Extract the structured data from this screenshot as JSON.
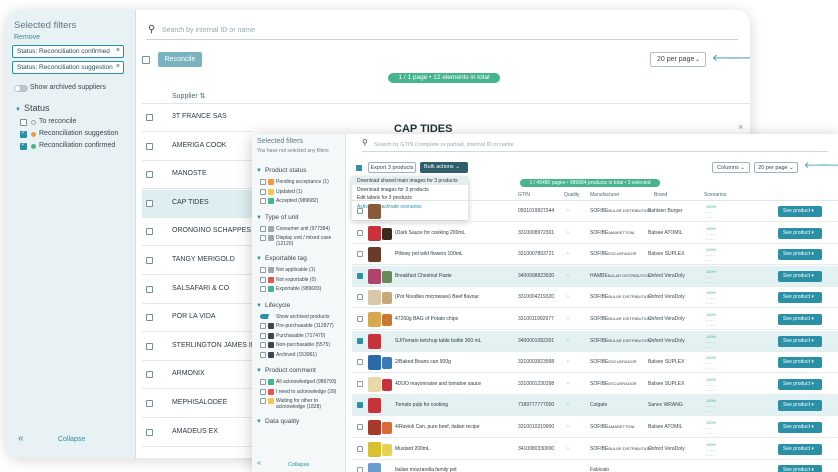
{
  "back": {
    "sidebar": {
      "title": "Selected filters",
      "remove": "Remove",
      "chips": [
        "Status: Reconciliation confirmed",
        "Status: Reconciliation suggestion"
      ],
      "chip_close": "×",
      "show_archived": "Show archived suppliers",
      "status_title": "Status",
      "status_options": [
        {
          "label": "To reconcile",
          "checked": false,
          "color": "#ffffff"
        },
        {
          "label": "Reconciliation suggestion",
          "checked": true,
          "color": "#f29a3a"
        },
        {
          "label": "Reconciliation confirmed",
          "checked": true,
          "color": "#46b58e"
        }
      ],
      "collapse": "Collapse",
      "collapse_icon": "«"
    },
    "search_placeholder": "Search by internal ID or name",
    "reconcile": "Reconcile",
    "per_page": "20 per page",
    "pagination": "1 / 1 page • 12 elements in total",
    "supplier_col": "Supplier",
    "suppliers": [
      "3T FRANCE SAS",
      "AMERIGA COOK",
      "MANOSTE",
      "CAP TIDES",
      "ORONGINO SCHAPPES",
      "TANGY MERIGOLD",
      "SALSAFARI & CO",
      "POR LA VIDA",
      "STERLINGTON JAMES INC",
      "ARMONIX",
      "MEPHISALODEE",
      "AMADEUS EX"
    ],
    "selected_supplier_index": 3,
    "detail_title": "CAP TIDES",
    "detail_close": "×"
  },
  "front": {
    "sidebar": {
      "title": "Selected filters",
      "subtitle": "You have not selected any filters",
      "sections": [
        {
          "title": "Product status",
          "options": [
            {
              "label": "Pending acceptance (1)",
              "color": "#f29a3a"
            },
            {
              "label": "Updated (1)",
              "color": "#f2c94c"
            },
            {
              "label": "Accepted (989682)",
              "color": "#46b58e"
            }
          ]
        },
        {
          "title": "Type of unit",
          "options": [
            {
              "label": "Consumer unit (977384)",
              "color": "#9aa9ae"
            },
            {
              "label": "Display unit / mixed case (12120)",
              "color": "#9aa9ae"
            }
          ]
        },
        {
          "title": "Exportable tag",
          "options": [
            {
              "label": "Not applicable (1)",
              "color": "#9aa9ae"
            },
            {
              "label": "Not exportable (0)",
              "color": "#e05555"
            },
            {
              "label": "Exportable (989683)",
              "color": "#46b58e"
            }
          ]
        },
        {
          "title": "Lifecycle",
          "options": [
            {
              "label": "Show archived products",
              "color": "toggle"
            },
            {
              "label": "Pre-purchasable (112877)",
              "color": "#3a4750"
            },
            {
              "label": "Purchasable (717470)",
              "color": "#3a4750"
            },
            {
              "label": "Non-purchasable (5575)",
              "color": "#3a4750"
            },
            {
              "label": "Archived (153961)",
              "color": "#3a4750"
            }
          ]
        },
        {
          "title": "Product comment",
          "options": [
            {
              "label": "All acknowledged (989793)",
              "color": "#46b58e"
            },
            {
              "label": "I need to acknowledge (29)",
              "color": "#e05555"
            },
            {
              "label": "Waiting for other to acknowledge (1828)",
              "color": "#f2c94c"
            }
          ]
        },
        {
          "title": "Data quality",
          "options": []
        }
      ],
      "collapse": "Collapse",
      "collapse_icon": "«"
    },
    "search_placeholder": "Search by GTIN (complete or partial), internal ID or name",
    "export_btn": "Export 3 products",
    "bulk_btn": "Bulk actions",
    "bulk_menu": [
      "Download shared main images for 3 products",
      "Download images for 3 products",
      "Edit labels for 3 products",
      "Activate/deactivate scenarios"
    ],
    "columns_btn": "Columns",
    "per_page": "20 per page",
    "pagination": "1 / 49480 pages • 989684 products in total • 3 selected",
    "col_headers": [
      "GTIN",
      "Quality",
      "Manufacturer",
      "Brand",
      "Scenarios"
    ],
    "products": [
      {
        "name": "",
        "gtin": "0501019927344",
        "manu": "SOFIBE",
        "dist": "BULAR DISTRIBUTION",
        "brand_owner": "Bahlsen",
        "brand": "Burger",
        "sel": false,
        "c1": "#8a5a3a",
        "c2": ""
      },
      {
        "name": "(Dark Sauce for cooking 200mL",
        "gtin": "3310008972301",
        "manu": "SOFIBE",
        "dist": "AMARETTONI",
        "brand_owner": "Balsee",
        "brand": "ATOMIL",
        "sel": false,
        "c1": "#c8323a",
        "c2": "#3a2a20"
      },
      {
        "name": "Pillowy pot wild flowers 100mL",
        "gtin": "3310007893721",
        "manu": "SOFIBE",
        "dist": "ESCUERADOR",
        "brand_owner": "Balsee",
        "brand": "SUPLEX",
        "sel": false,
        "c1": "#6a3a2a",
        "c2": ""
      },
      {
        "name": "Breakfast Chestnut Paste",
        "gtin": "3400998823930",
        "manu": "HAMBE",
        "dist": "BULAR DISTRIBUTION",
        "brand_owner": "Oxford",
        "brand": "VeraDoly",
        "sel": true,
        "c1": "#b0446a",
        "c2": "#6a8a5a"
      },
      {
        "name": "(Pot Noodles microwave) Beef flavour",
        "gtin": "3310004219320",
        "manu": "SOFIBE",
        "dist": "BULAR DISTRIBUTION",
        "brand_owner": "Oxford",
        "brand": "VeraDoly",
        "sel": false,
        "c1": "#d8c8a8",
        "c2": "#c8a878"
      },
      {
        "name": "47260g BAG of Potato chips",
        "gtin": "3310011992977",
        "manu": "SOFIBE",
        "dist": "BULAR DISTRIBUTION",
        "brand_owner": "Oxford",
        "brand": "VeraDoly",
        "sel": false,
        "c1": "#d8a850",
        "c2": "#c87a30"
      },
      {
        "name": "SJ/Tomato ketchup table bottle 300 mL",
        "gtin": "3400001082301",
        "manu": "SOFIBE",
        "dist": "BULAR DISTRIBUTION",
        "brand_owner": "Oxford",
        "brand": "VeraDoly",
        "sel": true,
        "c1": "#c8323a",
        "c2": ""
      },
      {
        "name": "2/Baked Beans can 500g",
        "gtin": "3310003823998",
        "manu": "SOFIBE",
        "dist": "ESCUERADOR",
        "brand_owner": "Balsee",
        "brand": "SUPLEX",
        "sel": false,
        "c1": "#2a6aa8",
        "c2": "#3a7ab8"
      },
      {
        "name": "4DUO mayonnaise and tomatoe sauce",
        "gtin": "3310001230398",
        "manu": "SOFIBE",
        "dist": "ESCUERADOR",
        "brand_owner": "Balsee",
        "brand": "SUPLEX",
        "sel": false,
        "c1": "#e8d8a8",
        "c2": "#c8323a"
      },
      {
        "name": "Tomato pulp for cooking",
        "gtin": "7189777777000",
        "manu": "Colgate",
        "dist": "",
        "brand_owner": "Sanex",
        "brand": "WRANG",
        "sel": true,
        "c1": "#c8323a",
        "c2": ""
      },
      {
        "name": "4/Ravioli Can, pure beef, italian recipe",
        "gtin": "3310010219900",
        "manu": "SOFIBE",
        "dist": "AMARETTONI",
        "brand_owner": "Balsee",
        "brand": "ATOMIL",
        "sel": false,
        "c1": "#a8382a",
        "c2": "#d86a3a"
      },
      {
        "name": "Mustard 200mL",
        "gtin": "3410080330000",
        "manu": "SOFIBE",
        "dist": "BULAR DISTRIBUTION",
        "brand_owner": "Oxford",
        "brand": "VeraDoly",
        "sel": false,
        "c1": "#d8c030",
        "c2": "#e8d050"
      },
      {
        "name": "Italian mozzarella family pot",
        "gtin": "",
        "manu": "Fabicato",
        "dist": "",
        "brand_owner": "",
        "brand": "",
        "sel": false,
        "c1": "#6a9ad0",
        "c2": ""
      }
    ],
    "scenario_label": "100%",
    "see_product": "See product",
    "see_chevron": "▾"
  }
}
